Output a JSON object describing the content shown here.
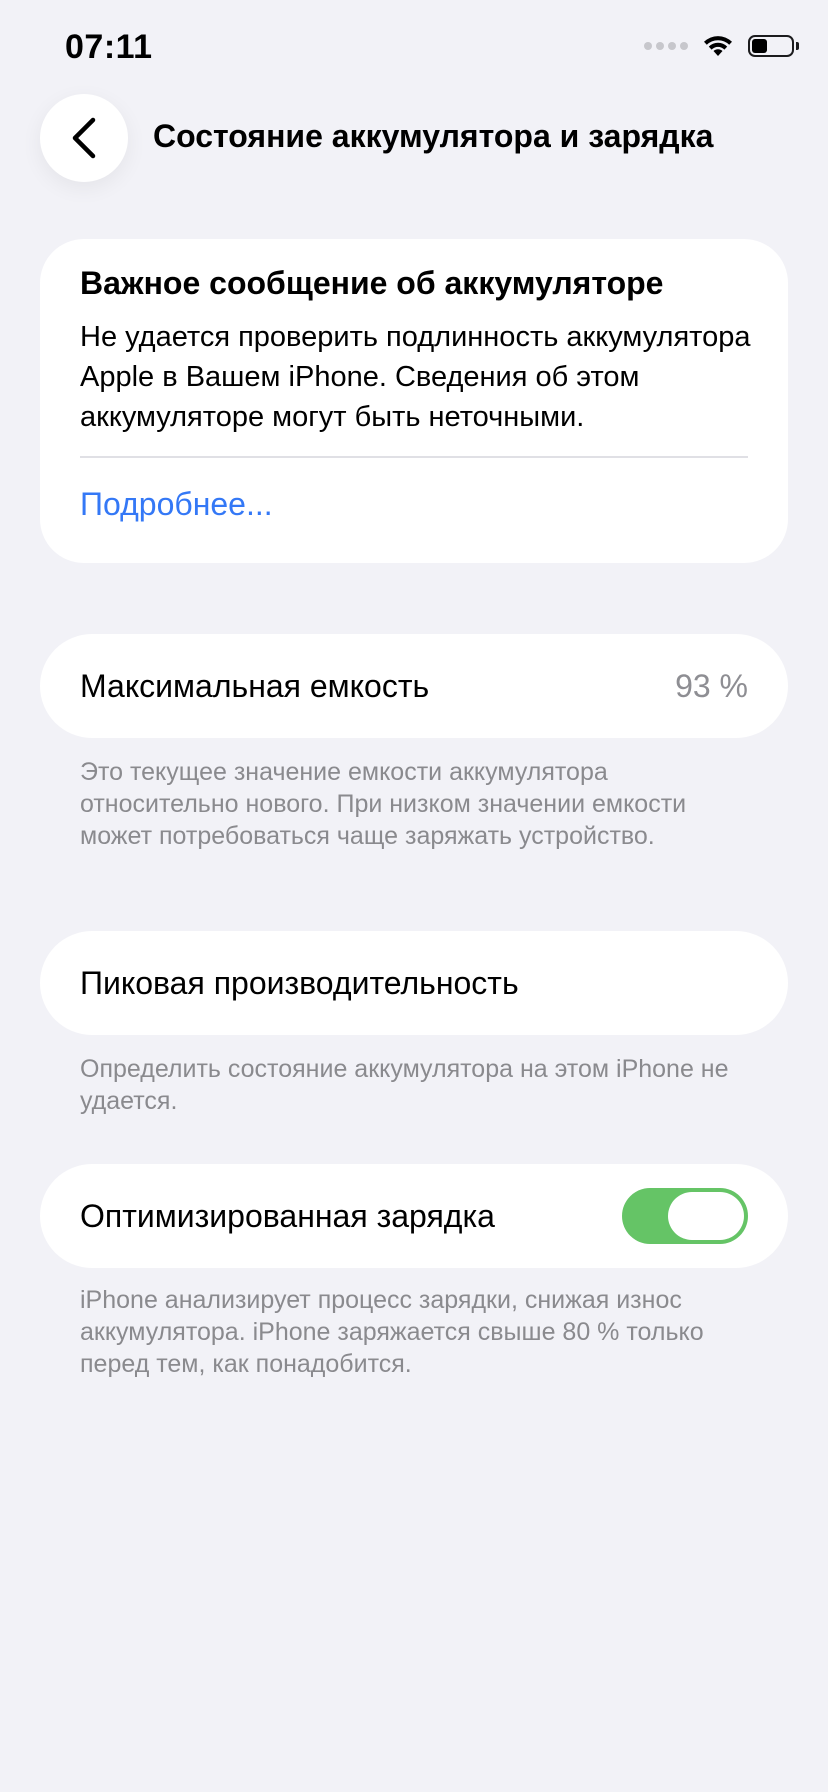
{
  "status_bar": {
    "time": "07:11",
    "battery_level": 0.45
  },
  "nav": {
    "title": "Состояние аккумулятора и зарядка",
    "back_icon": "chevron-left-icon"
  },
  "message_card": {
    "title": "Важное сообщение об аккумуляторе",
    "body": "Не удается проверить подлинность аккумуля­тора Apple в Вашем iPhone. Сведения об этом аккумуляторе могут быть неточными.",
    "link": "Подробнее..."
  },
  "max_capacity": {
    "label": "Максимальная емкость",
    "value": "93 %",
    "footnote": "Это текущее значение емкости аккумулятора относительно нового. При низком значении емкости может потребоваться чаще заряжать устройство."
  },
  "peak_performance": {
    "label": "Пиковая производительность",
    "footnote": "Определить состояние аккумулятора на этом iPhone не удается."
  },
  "optimized_charging": {
    "label": "Оптимизированная зарядка",
    "enabled": true,
    "footnote": "iPhone анализирует процесс зарядки, снижая износ аккумулятора. iPhone заряжается свыше 80 % только перед тем, как понадобится."
  },
  "colors": {
    "background": "#f2f2f7",
    "link": "#3478f6",
    "toggle_on": "#65c466",
    "secondary_text": "#8a8a8e"
  }
}
